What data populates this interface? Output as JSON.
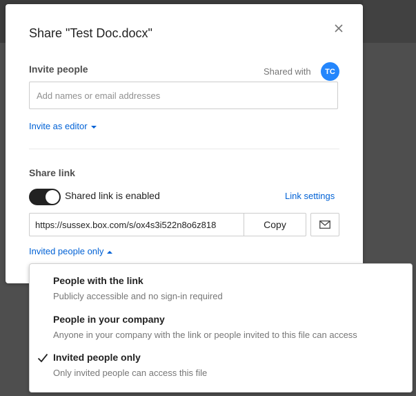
{
  "modal": {
    "title": "Share \"Test Doc.docx\"",
    "invite": {
      "label": "Invite people",
      "shared_with_label": "Shared with",
      "avatar_initials": "TC",
      "input_placeholder": "Add names or email addresses",
      "role_link": "Invite as editor"
    },
    "share_link": {
      "label": "Share link",
      "toggle_label": "Shared link is enabled",
      "toggle_on": true,
      "settings_link": "Link settings",
      "url": "https://sussex.box.com/s/ox4s3i522n8o6z818",
      "copy_label": "Copy",
      "access_link": "Invited people only"
    }
  },
  "access_dropdown": {
    "options": [
      {
        "title": "People with the link",
        "description": "Publicly accessible and no sign-in required",
        "selected": false
      },
      {
        "title": "People in your company",
        "description": "Anyone in your company with the link or people invited to this file can access",
        "selected": false
      },
      {
        "title": "Invited people only",
        "description": "Only invited people can access this file",
        "selected": true
      }
    ]
  },
  "icons": {
    "close": "close-icon",
    "role_caret": "chevron-down-icon",
    "access_caret": "chevron-up-icon",
    "email": "envelope-icon",
    "selected_check": "checkmark-icon"
  },
  "colors": {
    "link": "#0061d5",
    "avatar": "#2486fc",
    "toggle_on": "#222222"
  }
}
